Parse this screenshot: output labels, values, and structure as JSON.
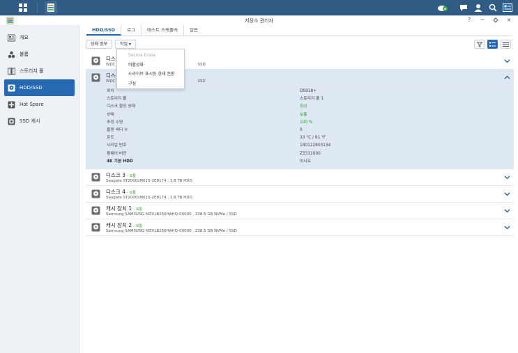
{
  "window": {
    "title": "저장소 관리자"
  },
  "tabs": [
    {
      "label": "HDD/SSD"
    },
    {
      "label": "로그"
    },
    {
      "label": "테스트 스케줄러"
    },
    {
      "label": "일반"
    }
  ],
  "toolbar": {
    "status_button": "상태 정보",
    "action_button": "작업 ▾"
  },
  "dropdown": [
    {
      "label": "Secure Erase",
      "disabled": true
    },
    {
      "label": "비활성화",
      "disabled": false
    },
    {
      "label": "드라이브 표시등 상태 전환",
      "disabled": false
    },
    {
      "label": "구성",
      "disabled": false
    }
  ],
  "sidebar": {
    "items": [
      {
        "label": "개요",
        "icon": "overview-icon"
      },
      {
        "label": "볼륨",
        "icon": "volume-icon"
      },
      {
        "label": "스토리지 풀",
        "icon": "storage-pool-icon"
      },
      {
        "label": "HDD/SSD",
        "icon": "hdd-icon"
      },
      {
        "label": "Hot Spare",
        "icon": "hot-spare-icon"
      },
      {
        "label": "SSD 캐시",
        "icon": "ssd-cache-icon"
      }
    ]
  },
  "disks": [
    {
      "name": "디스",
      "status": "",
      "model": "WDC",
      "model_tail": "SSD"
    },
    {
      "name": "디스",
      "status": "",
      "model": "WDC",
      "model_tail": "SSD"
    },
    {
      "name": "디스크 3",
      "status": "보통",
      "model": "Seagate ST2000LM015-2E8174 , 1.8 TB HDD"
    },
    {
      "name": "디스크 4",
      "status": "보통",
      "model": "Seagate ST2000LM015-2E8174 , 1.8 TB HDD"
    },
    {
      "name": "캐시 장치 1",
      "status": "보통",
      "model": "Samsung SAMSUNG MZVLB256HAHQ-00000 , 238.5 GB NVMe / SSD"
    },
    {
      "name": "캐시 장치 2",
      "status": "보통",
      "model": "Samsung SAMSUNG MZVLB256HAHQ-00000 , 238.5 GB NVMe / SSD"
    }
  ],
  "details": [
    {
      "key": "위치",
      "value": "DS918+"
    },
    {
      "key": "스토리지 풀",
      "value": "스토리지 풀 1"
    },
    {
      "key": "디스크 할당 상태",
      "value": "정상"
    },
    {
      "key": "상태",
      "value": "보통"
    },
    {
      "key": "추정 수명",
      "value": "100 %"
    },
    {
      "key": "불량 섹터 수",
      "value": "0"
    },
    {
      "key": "온도",
      "value": "33 °C / 91 °F"
    },
    {
      "key": "시리얼 번호",
      "value": "180122803134"
    },
    {
      "key": "펌웨어 버전",
      "value": "Z3311000"
    },
    {
      "key": "4K 기본 HDD",
      "value": "아니요"
    }
  ],
  "colors": {
    "accent": "#2469b2",
    "ok": "#2e9e2e",
    "topbar": "#2f5b85",
    "expanded": "#dde8f3"
  }
}
